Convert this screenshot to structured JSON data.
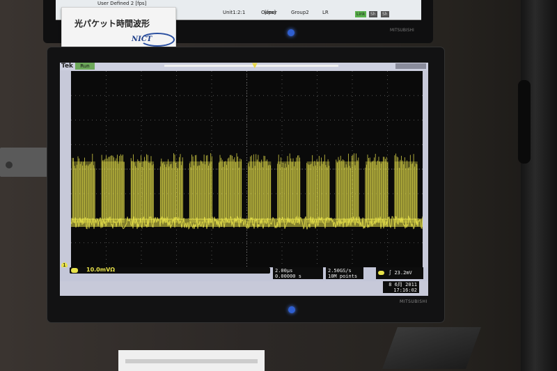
{
  "caption_card": {
    "title": "光パケット時間波形",
    "logo": "NICT"
  },
  "top_monitor": {
    "row1_text": "User Defined 2 [fps]",
    "fps_label": "[fps]",
    "unit_label": "Unit1:2:1",
    "owner_label": "Owner",
    "group_label": "Group2",
    "lr_label": "LR",
    "status_badges": [
      "Link",
      "Sh",
      "Sh"
    ],
    "brand": "MITSUBISHI"
  },
  "oscilloscope": {
    "logo": "Tek",
    "run_state": "Run",
    "channel": "1",
    "ch1_scale": "10.0mVΩ",
    "timebase": "2.00μs",
    "delay": "0.00000 s",
    "sample_rate": "2.50GS/s",
    "record_length": "10M points",
    "trigger_channel": "1",
    "trigger_slope": "∫",
    "trigger_level": "23.2mV",
    "date": "8 6月 2011",
    "time": "17:16:02",
    "trace_color": "#e8e24a",
    "packet_bursts": 12
  },
  "main_monitor": {
    "brand": "MITSUBISHI",
    "power_led_color": "#2f5fd0"
  }
}
